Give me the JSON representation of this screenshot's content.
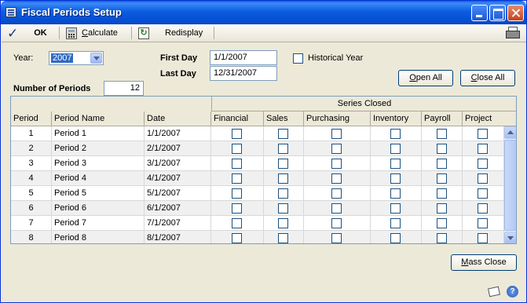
{
  "window": {
    "title": "Fiscal Periods Setup"
  },
  "toolbar": {
    "ok_label": "OK",
    "calculate_label": "Calculate",
    "redisplay_label": "Redisplay"
  },
  "form": {
    "year_label": "Year:",
    "year_value": "2007",
    "first_day_label": "First Day",
    "first_day_value": "1/1/2007",
    "last_day_label": "Last Day",
    "last_day_value": "12/31/2007",
    "historical_year_label": "Historical Year",
    "historical_year_checked": false,
    "number_of_periods_label": "Number of Periods",
    "number_of_periods_value": "12",
    "open_all_label": "Open All",
    "close_all_label": "Close All",
    "mass_close_label": "Mass Close"
  },
  "grid": {
    "series_closed_header": "Series Closed",
    "columns": [
      "Period",
      "Period Name",
      "Date",
      "Financial",
      "Sales",
      "Purchasing",
      "Inventory",
      "Payroll",
      "Project"
    ],
    "rows": [
      {
        "period": "1",
        "name": "Period 1",
        "date": "1/1/2007"
      },
      {
        "period": "2",
        "name": "Period 2",
        "date": "2/1/2007"
      },
      {
        "period": "3",
        "name": "Period 3",
        "date": "3/1/2007"
      },
      {
        "period": "4",
        "name": "Period 4",
        "date": "4/1/2007"
      },
      {
        "period": "5",
        "name": "Period 5",
        "date": "5/1/2007"
      },
      {
        "period": "6",
        "name": "Period 6",
        "date": "6/1/2007"
      },
      {
        "period": "7",
        "name": "Period 7",
        "date": "7/1/2007"
      },
      {
        "period": "8",
        "name": "Period 8",
        "date": "8/1/2007"
      }
    ]
  },
  "icons": {
    "app": "window-icon",
    "ok": "checkmark-icon",
    "calculate": "calculator-icon",
    "redisplay": "refresh-icon",
    "print": "printer-icon",
    "note": "note-icon",
    "help": "help-icon"
  },
  "colors": {
    "title_bar": "#0a5fd8",
    "window_bg": "#ece9d8",
    "selection": "#316ac5"
  }
}
